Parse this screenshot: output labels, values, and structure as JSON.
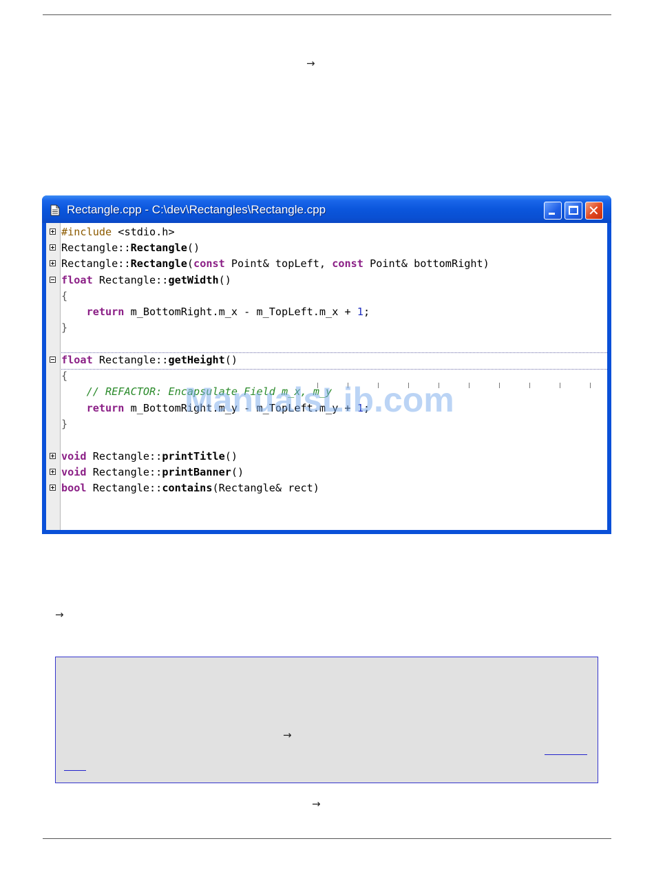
{
  "page": {
    "arrow": "→"
  },
  "window": {
    "title": "Rectangle.cpp - C:\\dev\\Rectangles\\Rectangle.cpp",
    "icons": [
      "document-icon",
      "minimize-icon",
      "maximize-icon",
      "close-icon"
    ]
  },
  "code": {
    "line1": {
      "pp": "#include ",
      "rest": "<stdio.h>"
    },
    "line2": {
      "cls": "Rectangle::",
      "fn": "Rectangle",
      "tail": "()"
    },
    "line3": {
      "cls": "Rectangle::",
      "fn": "Rectangle",
      "p1": "(",
      "kw1": "const",
      "a1": " Point& topLeft, ",
      "kw2": "const",
      "a2": " Point& bottomRight)"
    },
    "line4": {
      "kw": "float",
      "cls": " Rectangle::",
      "fn": "getWidth",
      "tail": "()"
    },
    "line5": "{",
    "line6": {
      "kw": "return",
      "a": " m_BottomRight.m_x - m_TopLeft.m_x + ",
      "num": "1",
      "end": ";"
    },
    "line7": "}",
    "line8": {
      "kw": "float",
      "cls": " Rectangle::",
      "fn": "getHeight",
      "tail": "()"
    },
    "line9": "{",
    "line10": {
      "comment": "// REFACTOR: Encapsulate Field m_x, m_y"
    },
    "line11": {
      "kw": "return",
      "a": " m_BottomRight.m_y - m_TopLeft.m_y + ",
      "num": "1",
      "end": ";"
    },
    "line12": "}",
    "line13": {
      "kw": "void",
      "cls": " Rectangle::",
      "fn": "printTitle",
      "tail": "()"
    },
    "line14": {
      "kw": "void",
      "cls": " Rectangle::",
      "fn": "printBanner",
      "tail": "()"
    },
    "line15": {
      "kw": "bool",
      "cls": " Rectangle::",
      "fn": "contains",
      "tail": "(Rectangle& rect)"
    }
  },
  "watermark": "ManualsLib.com",
  "colors": {
    "keyword": "#8b1f86",
    "preprocessor": "#8b5a00",
    "number": "#2030c0",
    "comment": "#2a8a2a",
    "titlebar": "#0b56dc",
    "note_background": "#e1e1e1",
    "note_border": "#3333cc"
  }
}
